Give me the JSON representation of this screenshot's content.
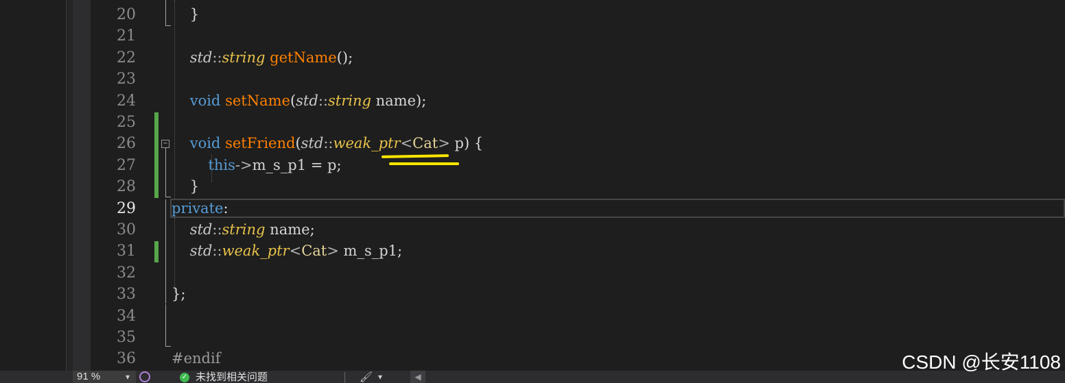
{
  "editor": {
    "lines": [
      {
        "number": "20",
        "tokens": [
          {
            "cls": "pl",
            "text": "    }"
          }
        ]
      },
      {
        "number": "21",
        "tokens": []
      },
      {
        "number": "22",
        "tokens": [
          {
            "cls": "pl",
            "text": "    "
          },
          {
            "cls": "ns",
            "text": "std"
          },
          {
            "cls": "op",
            "text": "::"
          },
          {
            "cls": "ty",
            "text": "string"
          },
          {
            "cls": "pl",
            "text": " "
          },
          {
            "cls": "fn",
            "text": "getName"
          },
          {
            "cls": "pl",
            "text": "();"
          }
        ]
      },
      {
        "number": "23",
        "tokens": []
      },
      {
        "number": "24",
        "tokens": [
          {
            "cls": "pl",
            "text": "    "
          },
          {
            "cls": "kw",
            "text": "void"
          },
          {
            "cls": "pl",
            "text": " "
          },
          {
            "cls": "fn",
            "text": "setName"
          },
          {
            "cls": "pl",
            "text": "("
          },
          {
            "cls": "ns",
            "text": "std"
          },
          {
            "cls": "op",
            "text": "::"
          },
          {
            "cls": "ty",
            "text": "string"
          },
          {
            "cls": "pl",
            "text": " "
          },
          {
            "cls": "id",
            "text": "name"
          },
          {
            "cls": "pl",
            "text": ");"
          }
        ]
      },
      {
        "number": "25",
        "tokens": []
      },
      {
        "number": "26",
        "tokens": [
          {
            "cls": "pl",
            "text": "    "
          },
          {
            "cls": "kw",
            "text": "void"
          },
          {
            "cls": "pl",
            "text": " "
          },
          {
            "cls": "fn",
            "text": "setFriend"
          },
          {
            "cls": "pl",
            "text": "("
          },
          {
            "cls": "ns",
            "text": "std"
          },
          {
            "cls": "op",
            "text": "::"
          },
          {
            "cls": "ty",
            "text": "weak_ptr"
          },
          {
            "cls": "op",
            "text": "<"
          },
          {
            "cls": "cls",
            "text": "Cat"
          },
          {
            "cls": "op",
            "text": ">"
          },
          {
            "cls": "pl",
            "text": " "
          },
          {
            "cls": "id",
            "text": "p"
          },
          {
            "cls": "pl",
            "text": ") {"
          }
        ]
      },
      {
        "number": "27",
        "tokens": [
          {
            "cls": "pl",
            "text": "        "
          },
          {
            "cls": "kw",
            "text": "this"
          },
          {
            "cls": "op",
            "text": "->"
          },
          {
            "cls": "id",
            "text": "m_s_p1"
          },
          {
            "cls": "pl",
            "text": " = "
          },
          {
            "cls": "id",
            "text": "p"
          },
          {
            "cls": "pl",
            "text": ";"
          }
        ]
      },
      {
        "number": "28",
        "tokens": [
          {
            "cls": "pl",
            "text": "    }"
          }
        ]
      },
      {
        "number": "29",
        "current": true,
        "tokens": [
          {
            "cls": "kw",
            "text": "private"
          },
          {
            "cls": "pl",
            "text": ":"
          }
        ]
      },
      {
        "number": "30",
        "tokens": [
          {
            "cls": "pl",
            "text": "    "
          },
          {
            "cls": "ns",
            "text": "std"
          },
          {
            "cls": "op",
            "text": "::"
          },
          {
            "cls": "ty",
            "text": "string"
          },
          {
            "cls": "pl",
            "text": " "
          },
          {
            "cls": "id",
            "text": "name"
          },
          {
            "cls": "pl",
            "text": ";"
          }
        ]
      },
      {
        "number": "31",
        "tokens": [
          {
            "cls": "pl",
            "text": "    "
          },
          {
            "cls": "ns",
            "text": "std"
          },
          {
            "cls": "op",
            "text": "::"
          },
          {
            "cls": "ty",
            "text": "weak_ptr"
          },
          {
            "cls": "op",
            "text": "<"
          },
          {
            "cls": "cls",
            "text": "Cat"
          },
          {
            "cls": "op",
            "text": ">"
          },
          {
            "cls": "pl",
            "text": " "
          },
          {
            "cls": "id",
            "text": "m_s_p1"
          },
          {
            "cls": "pl",
            "text": ";"
          }
        ]
      },
      {
        "number": "32",
        "tokens": []
      },
      {
        "number": "33",
        "tokens": [
          {
            "cls": "pl",
            "text": "};"
          }
        ]
      },
      {
        "number": "34",
        "tokens": []
      },
      {
        "number": "35",
        "tokens": []
      },
      {
        "number": "36",
        "tokens": [
          {
            "cls": "pp",
            "text": "#endif"
          }
        ]
      }
    ],
    "collapse_glyph": "−"
  },
  "statusbar": {
    "zoom": "91 %",
    "zoom_dropdown": "▾",
    "issues_icon": "check-circle-icon",
    "issues_text": "未找到相关问题",
    "brush_icon": "paintbrush-icon",
    "brush_glyph": "🖌",
    "brush_dropdown": "▾",
    "scroll_left_glyph": "◀"
  },
  "watermark": "CSDN @长安1108",
  "colors": {
    "background": "#1e1e1e",
    "keyword": "#569cd6",
    "function": "#ff8000",
    "type": "#e8c24a",
    "change_bar": "#57a64a",
    "annotation": "#ffe600"
  }
}
